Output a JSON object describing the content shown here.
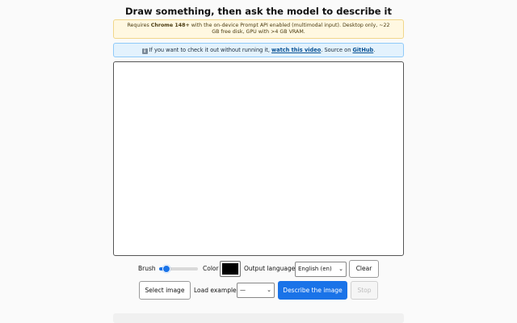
{
  "header": {
    "title": "Draw something, then ask the model to describe it"
  },
  "warning": {
    "prefix": "Requires ",
    "chrome": "Chrome 148+",
    "rest": " with the on-device Prompt API enabled (multimodal input). Desktop only, ~22 GB free disk, GPU with >4 GB VRAM."
  },
  "info": {
    "icon": "i",
    "text_before": "If you want to check it out without running it, ",
    "video_link": "watch this video",
    "text_mid": ". Source on ",
    "github_link": "GitHub",
    "text_after": "."
  },
  "controls": {
    "brush_label": "Brush",
    "brush_level": 0.1,
    "color_label": "Color",
    "color_value": "#000000",
    "language_label": "Output language",
    "language_selected": "English (en)",
    "clear_label": "Clear"
  },
  "actions": {
    "select_image_label": "Select image",
    "load_example_label": "Load example",
    "example_selected": "—",
    "describe_label": "Describe the image",
    "stop_label": "Stop"
  },
  "colors": {
    "accent": "#1a73e8"
  }
}
